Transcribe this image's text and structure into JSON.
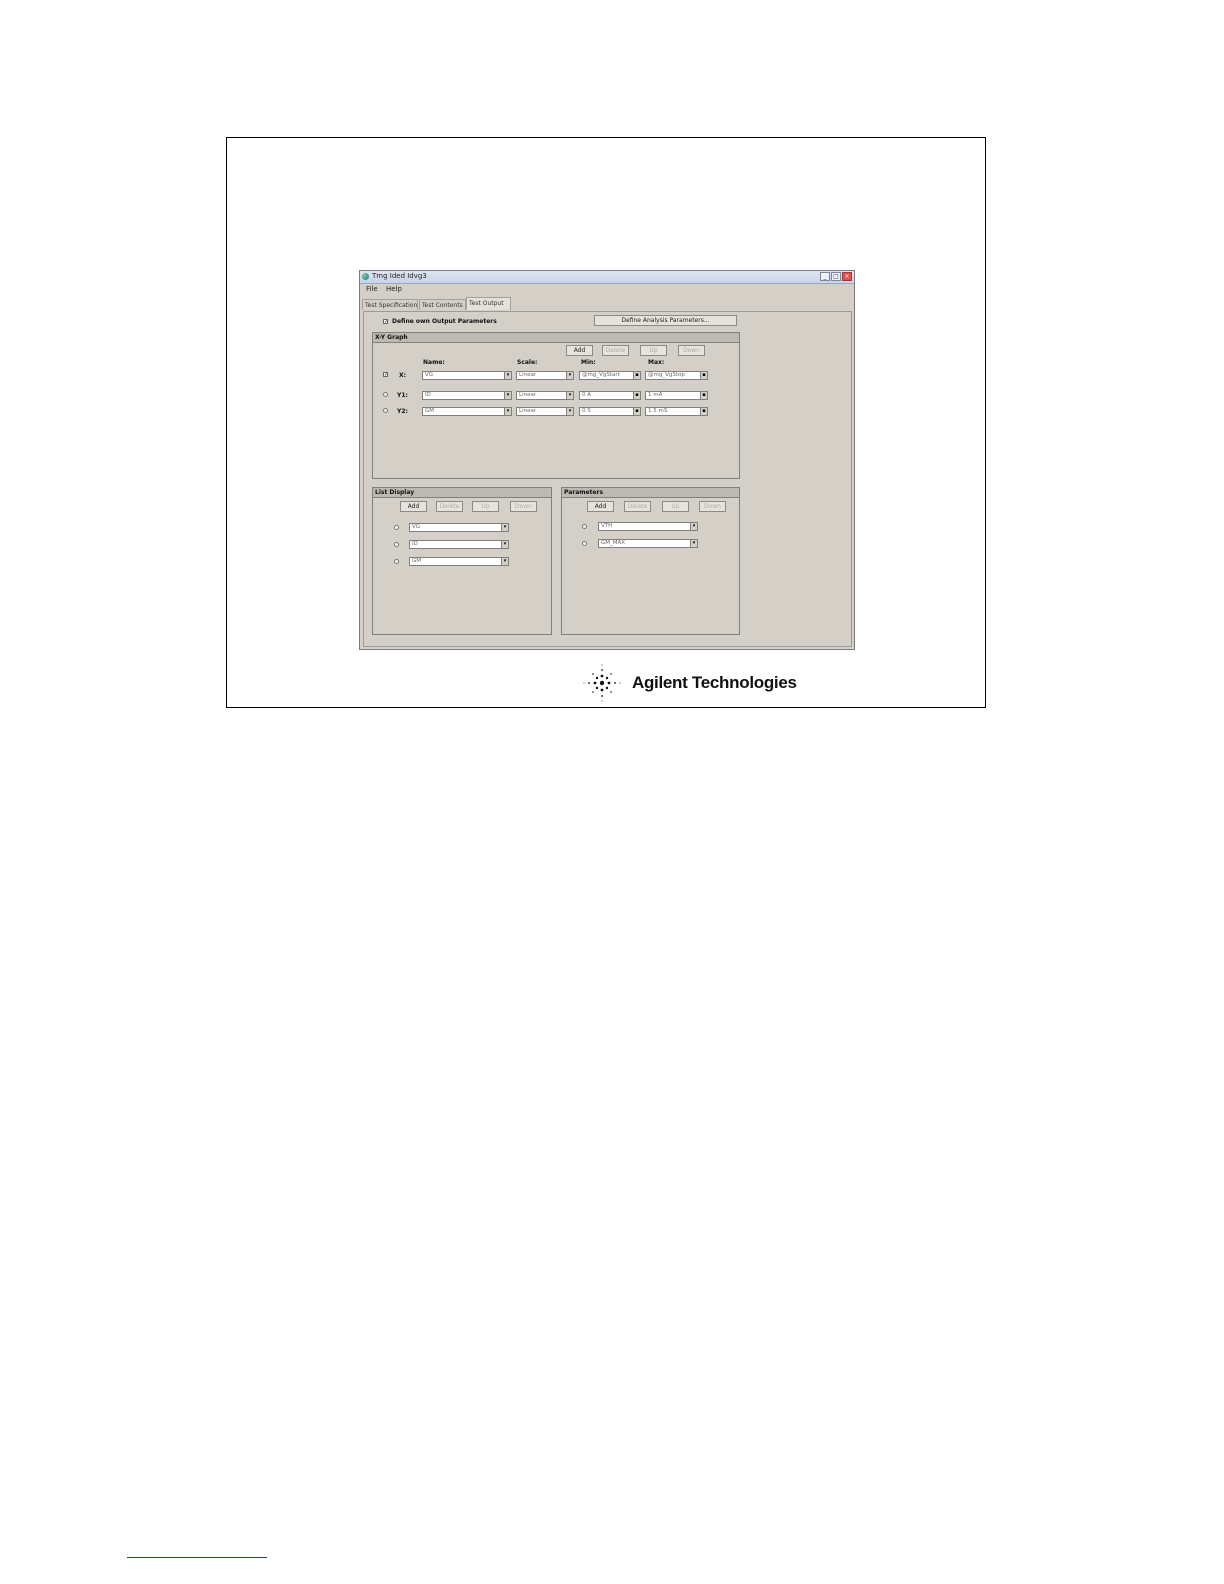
{
  "window": {
    "title": "Tmg Ided Idvg3",
    "menu": [
      "File",
      "Help"
    ],
    "tabs": [
      "Test Specification",
      "Test Contents",
      "Test Output"
    ],
    "active_tab": "Test Output",
    "controls": {
      "minimize": "_",
      "maximize": "□",
      "close": "×"
    }
  },
  "output": {
    "define_own_label": "Define own Output Parameters",
    "define_own_checked": true,
    "define_analysis_button": "Define Analysis Parameters..."
  },
  "xy_graph": {
    "title": "X-Y Graph",
    "buttons": [
      "Add",
      "Delete",
      "Up",
      "Down"
    ],
    "headers": {
      "name": "Name:",
      "scale": "Scale:",
      "min": "Min:",
      "max": "Max:"
    },
    "rows": [
      {
        "label": "X:",
        "name": "VG",
        "scale": "Linear",
        "min": "@mg_VgStart",
        "max": "@mg_VgStop"
      },
      {
        "label": "Y1:",
        "name": "ID",
        "scale": "Linear",
        "min": "0 A",
        "max": "1 mA"
      },
      {
        "label": "Y2:",
        "name": "GM",
        "scale": "Linear",
        "min": "0 S",
        "max": "1.5 mS"
      }
    ]
  },
  "list_display": {
    "title": "List Display",
    "buttons": [
      "Add",
      "Delete",
      "Up",
      "Down"
    ],
    "items": [
      "VG",
      "ID",
      "GM"
    ]
  },
  "parameters": {
    "title": "Parameters",
    "buttons": [
      "Add",
      "Delete",
      "Up",
      "Down"
    ],
    "items": [
      "VTH",
      "GM_MAX"
    ]
  },
  "logo": {
    "brand": "Agilent Technologies",
    "icon": "agilent-spark-icon",
    "color": "#111111"
  },
  "colors": {
    "window_bg": "#d4d0c8",
    "titlebar": "#c7d3ea",
    "close": "#d9534f"
  }
}
